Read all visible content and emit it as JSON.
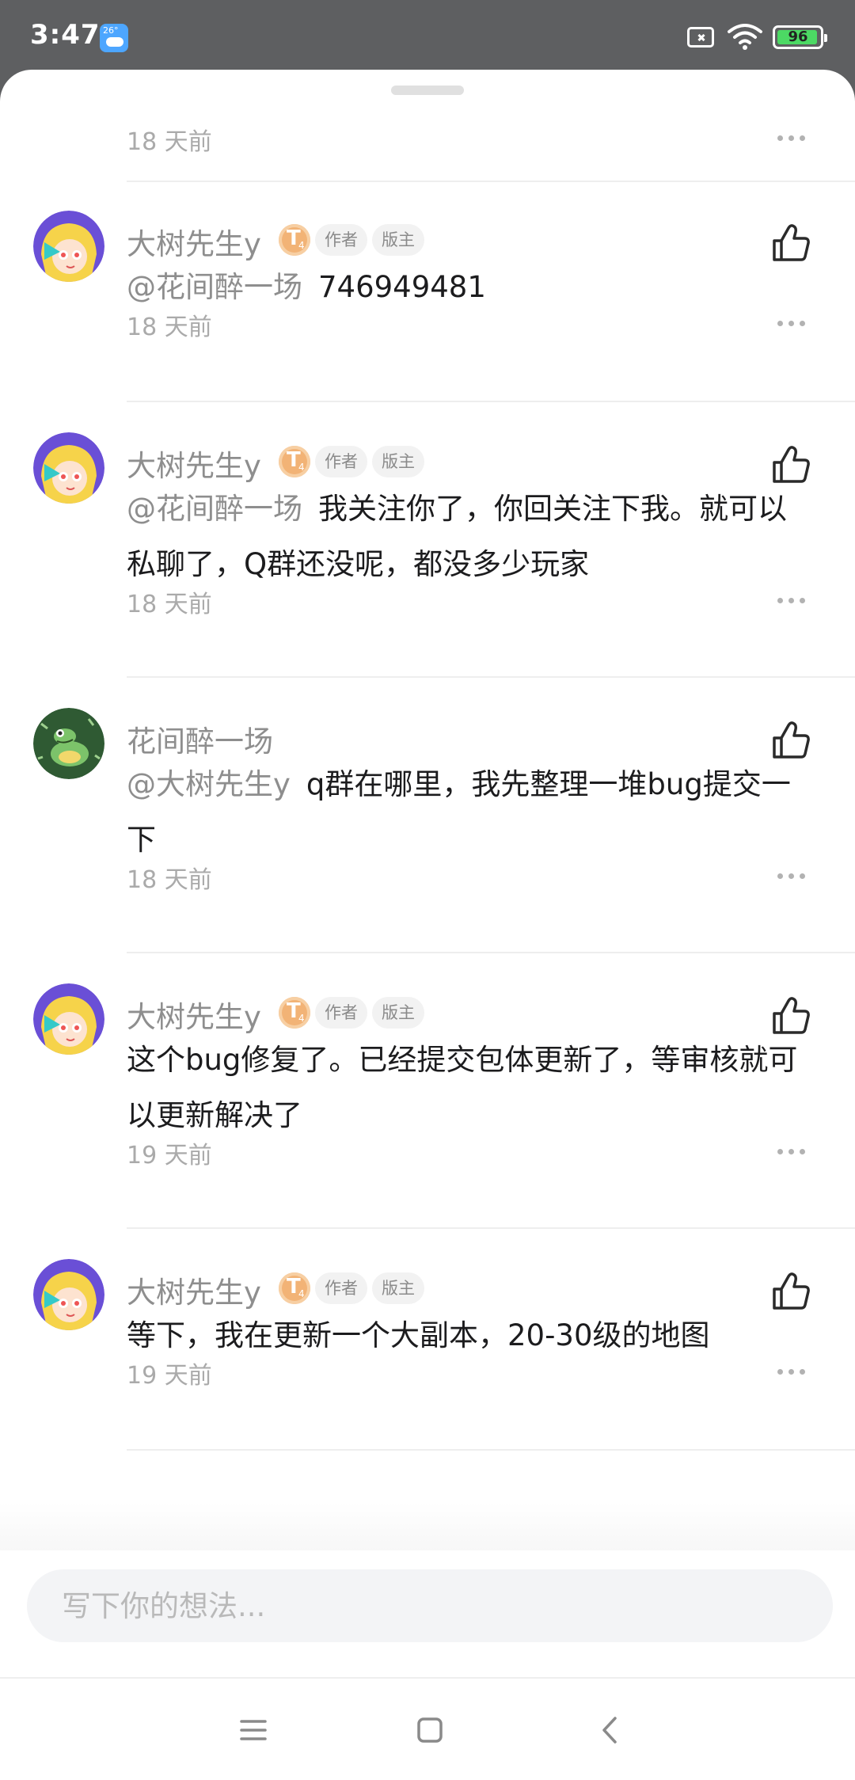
{
  "status_bar": {
    "time": "3:47",
    "weather_temp": "26°",
    "battery": "96",
    "battery_level": 0.96
  },
  "top_item": {
    "time": "18 天前"
  },
  "comments": [
    {
      "author": "大树先生y",
      "level": "T",
      "level_sub": "4",
      "tags": [
        "作者",
        "版主"
      ],
      "mention": "@花间醉一场",
      "text": "746949481",
      "time": "18 天前",
      "avatar": "anime-girl-avatar"
    },
    {
      "author": "大树先生y",
      "level": "T",
      "level_sub": "4",
      "tags": [
        "作者",
        "版主"
      ],
      "mention": "@花间醉一场",
      "line1": "我关注你了，你回关注下我。就可以",
      "line2": "私聊了，Q群还没呢，都没多少玩家",
      "time": "18 天前",
      "avatar": "anime-girl-avatar"
    },
    {
      "author": "花间醉一场",
      "mention": "@大树先生y",
      "line1": "q群在哪里，我先整理一堆bug提交一",
      "line2": "下",
      "time": "18 天前",
      "avatar": "frog-avatar"
    },
    {
      "author": "大树先生y",
      "level": "T",
      "level_sub": "4",
      "tags": [
        "作者",
        "版主"
      ],
      "line1": "这个bug修复了。已经提交包体更新了，等审核就可",
      "line2": "以更新解决了",
      "time": "19 天前",
      "avatar": "anime-girl-avatar"
    },
    {
      "author": "大树先生y",
      "level": "T",
      "level_sub": "4",
      "tags": [
        "作者",
        "版主"
      ],
      "line1": "等下，我在更新一个大副本，20-30级的地图",
      "time": "19 天前",
      "avatar": "anime-girl-avatar"
    }
  ],
  "input": {
    "placeholder": "写下你的想法..."
  },
  "colors": {
    "status_bar_bg": "#5e5f61",
    "muted_text": "#8e8e8e",
    "time_text": "#aaaaaa",
    "level_badge": "#f2b376",
    "battery_fill": "#4cd964"
  },
  "icons": [
    "thumbs-up-icon",
    "more-icon",
    "menu-icon",
    "home-icon",
    "back-icon",
    "wifi-icon",
    "battery-icon",
    "sim-off-icon",
    "weather-icon"
  ]
}
